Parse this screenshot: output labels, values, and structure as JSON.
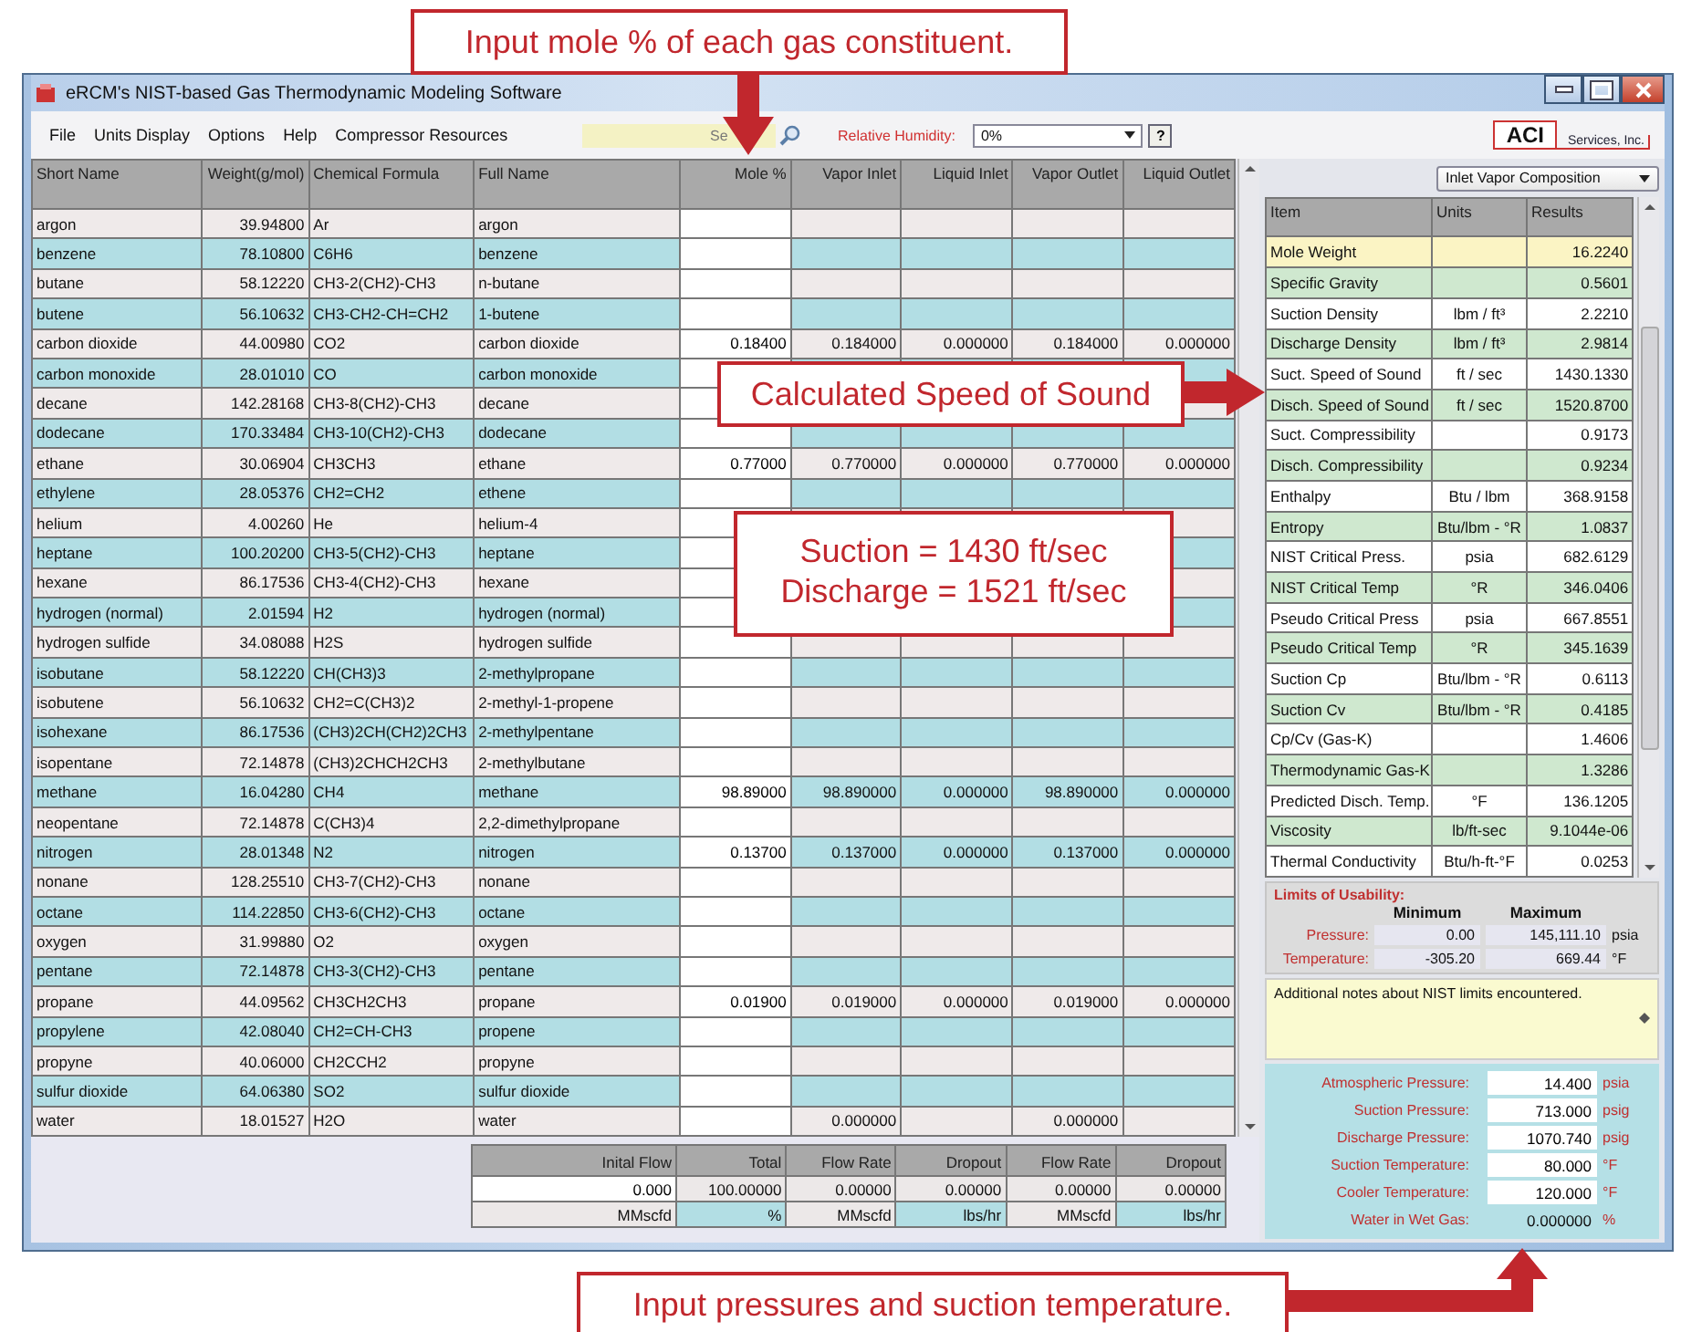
{
  "window": {
    "title": "eRCM's NIST-based Gas Thermodynamic Modeling Software"
  },
  "menu": [
    "File",
    "Units Display",
    "Options",
    "Help",
    "Compressor Resources"
  ],
  "search": {
    "placeholder": "Se"
  },
  "humidity": {
    "label": "Relative Humidity:",
    "value": "0%"
  },
  "help_button": "?",
  "logo": {
    "mark": "ACI",
    "text": "Services, Inc."
  },
  "components": {
    "columns": [
      {
        "label": "Short Name",
        "kind": "text"
      },
      {
        "label": "Weight(g/mol)",
        "kind": "number"
      },
      {
        "label": "Chemical Formula",
        "kind": "text"
      },
      {
        "label": "Full Name",
        "kind": "text"
      },
      {
        "label": "Mole %",
        "kind": "input"
      },
      {
        "label": "Vapor Inlet",
        "kind": "number"
      },
      {
        "label": "Liquid Inlet",
        "kind": "number"
      },
      {
        "label": "Vapor Outlet",
        "kind": "number"
      },
      {
        "label": "Liquid Outlet",
        "kind": "number"
      }
    ],
    "rows": [
      [
        "argon",
        "39.94800",
        "Ar",
        "argon",
        null,
        null,
        null,
        null,
        null
      ],
      [
        "benzene",
        "78.10800",
        "C6H6",
        "benzene",
        null,
        null,
        null,
        null,
        null
      ],
      [
        "butane",
        "58.12220",
        "CH3-2(CH2)-CH3",
        "n-butane",
        null,
        null,
        null,
        null,
        null
      ],
      [
        "butene",
        "56.10632",
        "CH3-CH2-CH=CH2",
        "1-butene",
        null,
        null,
        null,
        null,
        null
      ],
      [
        "carbon dioxide",
        "44.00980",
        "CO2",
        "carbon dioxide",
        "0.18400",
        "0.184000",
        "0.000000",
        "0.184000",
        "0.000000"
      ],
      [
        "carbon monoxide",
        "28.01010",
        "CO",
        "carbon monoxide",
        null,
        null,
        null,
        null,
        null
      ],
      [
        "decane",
        "142.28168",
        "CH3-8(CH2)-CH3",
        "decane",
        null,
        null,
        null,
        null,
        null
      ],
      [
        "dodecane",
        "170.33484",
        "CH3-10(CH2)-CH3",
        "dodecane",
        null,
        null,
        null,
        null,
        null
      ],
      [
        "ethane",
        "30.06904",
        "CH3CH3",
        "ethane",
        "0.77000",
        "0.770000",
        "0.000000",
        "0.770000",
        "0.000000"
      ],
      [
        "ethylene",
        "28.05376",
        "CH2=CH2",
        "ethene",
        null,
        null,
        null,
        null,
        null
      ],
      [
        "helium",
        "4.00260",
        "He",
        "helium-4",
        null,
        null,
        null,
        null,
        null
      ],
      [
        "heptane",
        "100.20200",
        "CH3-5(CH2)-CH3",
        "heptane",
        null,
        null,
        null,
        null,
        null
      ],
      [
        "hexane",
        "86.17536",
        "CH3-4(CH2)-CH3",
        "hexane",
        null,
        null,
        null,
        null,
        null
      ],
      [
        "hydrogen (normal)",
        "2.01594",
        "H2",
        "hydrogen (normal)",
        null,
        null,
        null,
        null,
        null
      ],
      [
        "hydrogen sulfide",
        "34.08088",
        "H2S",
        "hydrogen sulfide",
        null,
        null,
        null,
        null,
        null
      ],
      [
        "isobutane",
        "58.12220",
        "CH(CH3)3",
        "2-methylpropane",
        null,
        null,
        null,
        null,
        null
      ],
      [
        "isobutene",
        "56.10632",
        "CH2=C(CH3)2",
        "2-methyl-1-propene",
        null,
        null,
        null,
        null,
        null
      ],
      [
        "isohexane",
        "86.17536",
        "(CH3)2CH(CH2)2CH3",
        "2-methylpentane",
        null,
        null,
        null,
        null,
        null
      ],
      [
        "isopentane",
        "72.14878",
        "(CH3)2CHCH2CH3",
        "2-methylbutane",
        null,
        null,
        null,
        null,
        null
      ],
      [
        "methane",
        "16.04280",
        "CH4",
        "methane",
        "98.89000",
        "98.890000",
        "0.000000",
        "98.890000",
        "0.000000"
      ],
      [
        "neopentane",
        "72.14878",
        "C(CH3)4",
        "2,2-dimethylpropane",
        null,
        null,
        null,
        null,
        null
      ],
      [
        "nitrogen",
        "28.01348",
        "N2",
        "nitrogen",
        "0.13700",
        "0.137000",
        "0.000000",
        "0.137000",
        "0.000000"
      ],
      [
        "nonane",
        "128.25510",
        "CH3-7(CH2)-CH3",
        "nonane",
        null,
        null,
        null,
        null,
        null
      ],
      [
        "octane",
        "114.22850",
        "CH3-6(CH2)-CH3",
        "octane",
        null,
        null,
        null,
        null,
        null
      ],
      [
        "oxygen",
        "31.99880",
        "O2",
        "oxygen",
        null,
        null,
        null,
        null,
        null
      ],
      [
        "pentane",
        "72.14878",
        "CH3-3(CH2)-CH3",
        "pentane",
        null,
        null,
        null,
        null,
        null
      ],
      [
        "propane",
        "44.09562",
        "CH3CH2CH3",
        "propane",
        "0.01900",
        "0.019000",
        "0.000000",
        "0.019000",
        "0.000000"
      ],
      [
        "propylene",
        "42.08040",
        "CH2=CH-CH3",
        "propene",
        null,
        null,
        null,
        null,
        null
      ],
      [
        "propyne",
        "40.06000",
        "CH2CCH2",
        "propyne",
        null,
        null,
        null,
        null,
        null
      ],
      [
        "sulfur dioxide",
        "64.06380",
        "SO2",
        "sulfur dioxide",
        null,
        null,
        null,
        null,
        null
      ],
      [
        "water",
        "18.01527",
        "H2O",
        "water",
        null,
        "0.000000",
        null,
        "0.000000",
        null
      ]
    ]
  },
  "totals": {
    "columns": [
      {
        "label": "Inital Flow",
        "kind": "input"
      },
      {
        "label": "Total",
        "kind": "number"
      },
      {
        "label": "Flow Rate",
        "kind": "number"
      },
      {
        "label": "Dropout",
        "kind": "number"
      },
      {
        "label": "Flow Rate",
        "kind": "number"
      },
      {
        "label": "Dropout",
        "kind": "number"
      }
    ],
    "rows": [
      {
        "kind": "values",
        "cells": [
          "0.000",
          "100.00000",
          "0.00000",
          "0.00000",
          "0.00000",
          "0.00000"
        ]
      },
      {
        "kind": "units",
        "cells": [
          "MMscfd",
          "%",
          "MMscfd",
          "lbs/hr",
          "MMscfd",
          "lbs/hr"
        ]
      }
    ]
  },
  "composition_select": "Inlet Vapor Composition",
  "results": {
    "columns": [
      "Item",
      "Units",
      "Results"
    ],
    "rows": [
      {
        "item": "Mole Weight",
        "value": "16.2240",
        "selected": true
      },
      {
        "item": "Specific Gravity",
        "value": "0.5601",
        "selected": false
      },
      {
        "item": "Suction Density",
        "units": "lbm / ft³",
        "value": "2.2210",
        "selected": false
      },
      {
        "item": "Discharge Density",
        "units": "lbm / ft³",
        "value": "2.9814",
        "selected": false
      },
      {
        "item": "Suct. Speed of Sound",
        "units": "ft / sec",
        "value": "1430.1330",
        "selected": false
      },
      {
        "item": "Disch. Speed of Sound",
        "units": "ft / sec",
        "value": "1520.8700",
        "selected": false
      },
      {
        "item": "Suct. Compressibility",
        "value": "0.9173",
        "selected": false
      },
      {
        "item": "Disch. Compressibility",
        "value": "0.9234",
        "selected": false
      },
      {
        "item": "Enthalpy",
        "units": "Btu / lbm",
        "value": "368.9158",
        "selected": false
      },
      {
        "item": "Entropy",
        "units": "Btu/lbm - °R",
        "value": "1.0837",
        "selected": false
      },
      {
        "item": "NIST Critical Press.",
        "units": "psia",
        "value": "682.6129",
        "selected": false
      },
      {
        "item": "NIST Critical Temp",
        "units": "°R",
        "value": "346.0406",
        "selected": false
      },
      {
        "item": "Pseudo Critical Press",
        "units": "psia",
        "value": "667.8551",
        "selected": false
      },
      {
        "item": "Pseudo Critical Temp",
        "units": "°R",
        "value": "345.1639",
        "selected": false
      },
      {
        "item": "Suction Cp",
        "units": "Btu/lbm - °R",
        "value": "0.6113",
        "selected": false
      },
      {
        "item": "Suction Cv",
        "units": "Btu/lbm - °R",
        "value": "0.4185",
        "selected": false
      },
      {
        "item": "Cp/Cv (Gas-K)",
        "value": "1.4606",
        "selected": false
      },
      {
        "item": "Thermodynamic Gas-K",
        "value": "1.3286",
        "selected": false
      },
      {
        "item": "Predicted Disch. Temp.",
        "units": "°F",
        "value": "136.1205",
        "selected": false
      },
      {
        "item": "Viscosity",
        "units": "lb/ft-sec",
        "value": "9.1044e-06",
        "selected": false
      },
      {
        "item": "Thermal Conductivity",
        "units": "Btu/h-ft-°F",
        "value": "0.0253",
        "selected": false
      }
    ]
  },
  "limits": {
    "title": "Limits of Usability:",
    "headers": [
      "Minimum",
      "Maximum"
    ],
    "rows": [
      {
        "label": "Pressure:",
        "min": "0.00",
        "max": "145,111.10",
        "unit": "psia"
      },
      {
        "label": "Temperature:",
        "min": "-305.20",
        "max": "669.44",
        "unit": "°F"
      }
    ]
  },
  "notes": "Additional notes about NIST limits encountered.",
  "conditions": [
    {
      "label": "Atmospheric Pressure:",
      "value": "14.400",
      "unit": "psia",
      "kind": "input"
    },
    {
      "label": "Suction Pressure:",
      "value": "713.000",
      "unit": "psig",
      "kind": "input"
    },
    {
      "label": "Discharge Pressure:",
      "value": "1070.740",
      "unit": "psig",
      "kind": "input"
    },
    {
      "label": "Suction Temperature:",
      "value": "80.000",
      "unit": "°F",
      "kind": "input"
    },
    {
      "label": "Cooler Temperature:",
      "value": "120.000",
      "unit": "°F",
      "kind": "input"
    },
    {
      "label": "Water in Wet Gas:",
      "value": "0.000000",
      "unit": "%",
      "kind": "readout"
    }
  ],
  "callouts": [
    {
      "lines": [
        "Input mole % of each gas constituent."
      ]
    },
    {
      "lines": [
        "Calculated Speed of Sound"
      ]
    },
    {
      "lines": [
        "Suction = 1430 ft/sec",
        "Discharge = 1521 ft/sec"
      ]
    },
    {
      "lines": [
        "Input pressures and suction temperature."
      ]
    }
  ]
}
